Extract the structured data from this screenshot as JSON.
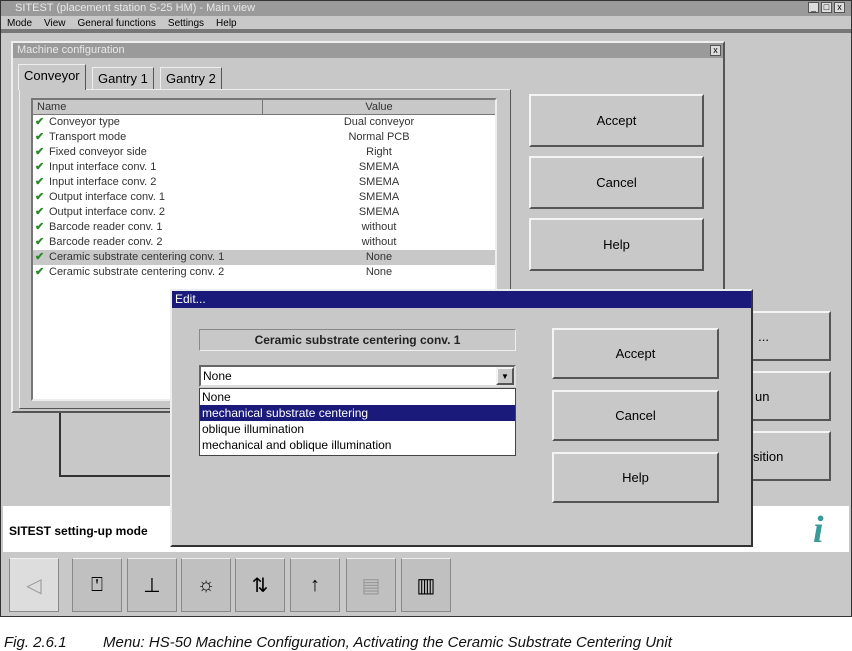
{
  "window": {
    "title": "SITEST (placement station S-25 HM) - Main view",
    "controls": [
      "_",
      "□",
      "x"
    ]
  },
  "menu": [
    "Mode",
    "View",
    "General functions",
    "Settings",
    "Help"
  ],
  "config_dialog": {
    "title": "Machine configuration",
    "close": "x",
    "tabs": [
      "Conveyor",
      "Gantry 1",
      "Gantry 2"
    ],
    "columns": [
      "Name",
      "Value"
    ],
    "rows": [
      {
        "name": "Conveyor type",
        "value": "Dual conveyor"
      },
      {
        "name": "Transport mode",
        "value": "Normal PCB"
      },
      {
        "name": "Fixed conveyor side",
        "value": "Right"
      },
      {
        "name": "Input interface conv. 1",
        "value": "SMEMA"
      },
      {
        "name": "Input interface conv. 2",
        "value": "SMEMA"
      },
      {
        "name": "Output interface conv. 1",
        "value": "SMEMA"
      },
      {
        "name": "Output interface conv. 2",
        "value": "SMEMA"
      },
      {
        "name": "Barcode reader conv. 1",
        "value": "without"
      },
      {
        "name": "Barcode reader conv. 2",
        "value": "without"
      },
      {
        "name": "Ceramic substrate centering conv. 1",
        "value": "None"
      },
      {
        "name": "Ceramic substrate centering conv. 2",
        "value": "None"
      }
    ],
    "buttons": {
      "accept": "Accept",
      "cancel": "Cancel",
      "help": "Help"
    }
  },
  "background_buttons": [
    "...",
    "un",
    "sition"
  ],
  "edit_dialog": {
    "title": "Edit...",
    "label": "Ceramic substrate centering conv. 1",
    "selected": "None",
    "options": [
      "None",
      "mechanical substrate centering",
      "oblique illumination",
      "mechanical and oblique illumination"
    ],
    "highlighted_index": 1,
    "buttons": {
      "accept": "Accept",
      "cancel": "Cancel",
      "help": "Help"
    }
  },
  "status": {
    "text": "SITEST setting-up mode",
    "info_icon": "i"
  },
  "caption": {
    "fig": "Fig. 2.6.1",
    "text": "Menu: HS-50 Machine Configuration, Activating the Ceramic Substrate Centering Unit"
  }
}
